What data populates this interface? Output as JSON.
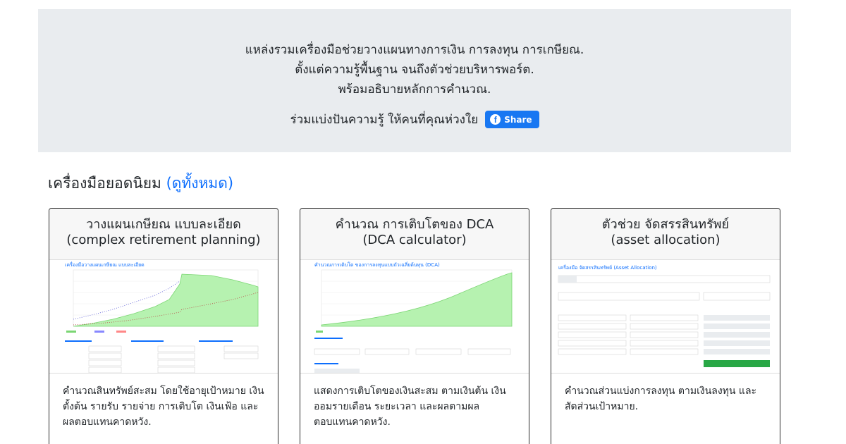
{
  "hero": {
    "lines": [
      "แหล่งรวมเครื่องมือช่วยวางแผนทางการเงิน การลงทุน การเกษียณ.",
      "ตั้งแต่ความรู้พื้นฐาน จนถึงตัวช่วยบริหารพอร์ต.",
      "พร้อมอธิบายหลักการคำนวณ."
    ],
    "share_text": "ร่วมแบ่งปันความรู้ ให้คนที่คุณห่วงใย",
    "share_button": "Share",
    "share_color": "#1877f2",
    "share_icon": "facebook-icon"
  },
  "section": {
    "title": "เครื่องมือยอดนิยม",
    "see_all": "(ดูทั้งหมด)",
    "link_color": "#0d6efd"
  },
  "cards": [
    {
      "title_th": "วางแผนเกษียณ แบบละเอียด",
      "title_en": "(complex retirement planning)",
      "desc": "คำนวณสินทรัพย์สะสม โดยใช้อายุเป้าหมาย เงินตั้งต้น รายรับ รายจ่าย การเติบโต เงินเฟ้อ และผลตอบแทนคาดหวัง.",
      "preview_title": "เครื่องมือวางแผนเกษียณ แบบละเอียด"
    },
    {
      "title_th": "คำนวณ การเติบโตของ DCA",
      "title_en": "(DCA calculator)",
      "desc": "แสดงการเติบโตของเงินสะสม ตามเงินต้น เงินออมรายเดือน ระยะเวลา และผลตามผลตอบแทนคาดหวัง.",
      "preview_title": "คำนวณการเติบโต ของการลงทุนแบบถัวเฉลี่ยต้นทุน (DCA)"
    },
    {
      "title_th": "ตัวช่วย จัดสรรสินทรัพย์",
      "title_en": "(asset allocation)",
      "desc": "คำนวณส่วนแบ่งการลงทุน ตามเงินลงทุน และสัดส่วนเป้าหมาย.",
      "preview_title": "เครื่องมือ จัดสรรสินทรัพย์ (Asset Allocation)"
    }
  ]
}
